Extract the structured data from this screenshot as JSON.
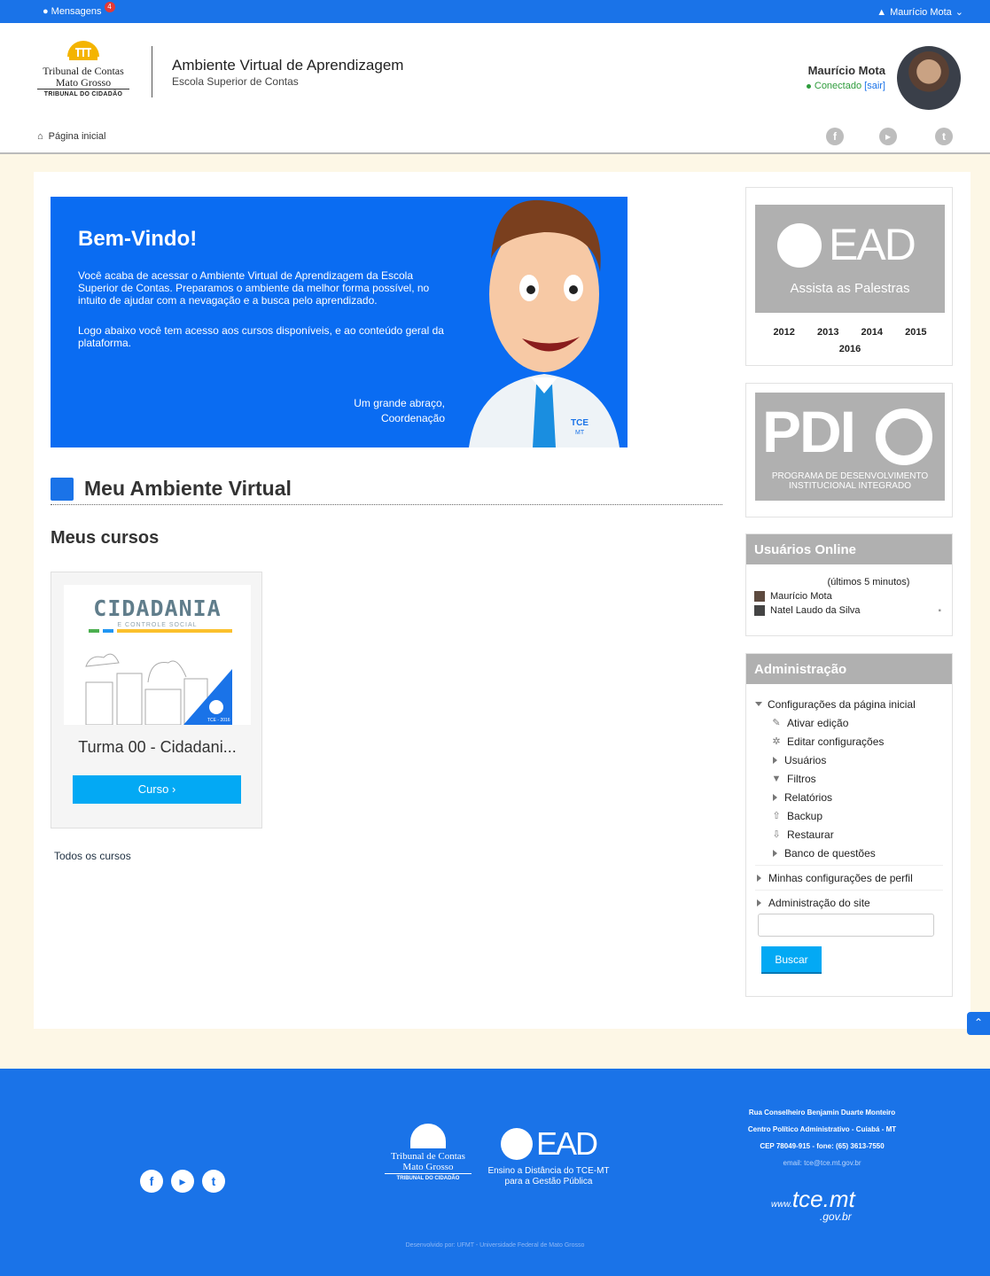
{
  "topbar": {
    "messages_label": "Mensagens",
    "messages_count": "4",
    "user_label": "Maurício Mota"
  },
  "logo": {
    "line1": "Tribunal de Contas",
    "line2": "Mato Grosso",
    "line3": "TRIBUNAL DO CIDADÃO"
  },
  "site": {
    "title": "Ambiente Virtual de Aprendizagem",
    "subtitle": "Escola Superior de Contas"
  },
  "profile": {
    "name": "Maurício Mota",
    "status": "Conectado",
    "logout": "[sair]"
  },
  "breadcrumb": {
    "home": "Página inicial"
  },
  "banner": {
    "title": "Bem-Vindo!",
    "para1": "Você acaba de acessar o Ambiente Virtual de Aprendizagem da Escola Superior de Contas. Preparamos o ambiente da melhor forma possível, no intuito de ajudar com a nevagação e a busca pelo aprendizado.",
    "para2": "Logo abaixo você tem acesso aos cursos disponíveis, e ao conteúdo geral da plataforma.",
    "sign1": "Um grande abraço,",
    "sign2": "Coordenação",
    "badge": "TCE",
    "badge_sub": "MT"
  },
  "section": {
    "title": "Meu Ambiente Virtual",
    "courses_heading": "Meus cursos",
    "all_courses": "Todos os cursos"
  },
  "course": {
    "thumb_title": "CIDADANIA",
    "thumb_sub": "E CONTROLE SOCIAL",
    "thumb_badge": "TCE - 2016",
    "title": "Turma 00 - Cidadani...",
    "button": "Curso ›"
  },
  "ead_block": {
    "big": "EAD",
    "subtitle": "Assista as Palestras",
    "years": [
      "2012",
      "2013",
      "2014",
      "2015"
    ],
    "year_extra": "2016"
  },
  "pdi_block": {
    "big": "PDI",
    "caption1": "PROGRAMA DE DESENVOLVIMENTO",
    "caption2": "INSTITUCIONAL INTEGRADO"
  },
  "online": {
    "title": "Usuários Online",
    "subtitle": "(últimos 5 minutos)",
    "users": [
      "Maurício Mota",
      "Natel Laudo da Silva"
    ]
  },
  "admin": {
    "title": "Administração",
    "front": "Configurações da página inicial",
    "items": [
      "Ativar edição",
      "Editar configurações",
      "Usuários",
      "Filtros",
      "Relatórios",
      "Backup",
      "Restaurar",
      "Banco de questões"
    ],
    "profile": "Minhas configurações de perfil",
    "site": "Administração do site",
    "search_button": "Buscar"
  },
  "footer": {
    "logo1": "Tribunal de Contas",
    "logo2": "Mato Grosso",
    "logo3": "TRIBUNAL DO CIDADÃO",
    "ead_big": "EAD",
    "ead_cap1": "Ensino a Distância do TCE-MT",
    "ead_cap2": "para a Gestão Pública",
    "addr1": "Rua Conselheiro Benjamin Duarte Monteiro",
    "addr2": "Centro Político Administrativo - Cuiabá - MT",
    "addr3": "CEP 78049-915 - fone: (65) 3613-7550",
    "email": "email: tce@tce.mt.gov.br",
    "site_www": "www.",
    "site_main": "tce.mt",
    "site_gov": ".gov.br",
    "dev": "Desenvolvido por: UFMT - Universidade Federal de Mato Grosso"
  },
  "colors": {
    "primary": "#1a73e8",
    "button": "#03a9f4",
    "block_gray": "#b0b0b0",
    "page_bg": "#fdf7e6"
  }
}
